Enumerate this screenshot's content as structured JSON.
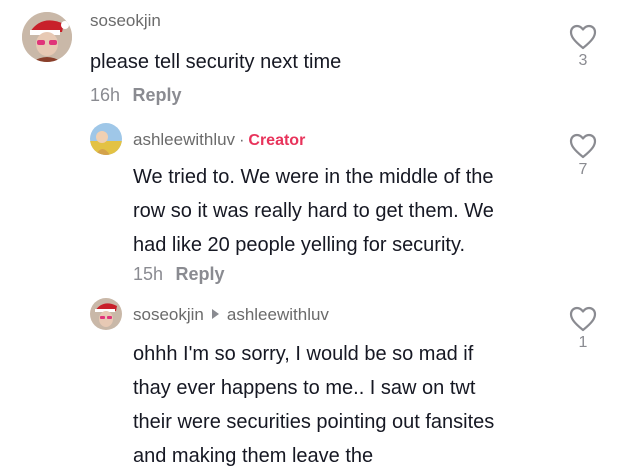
{
  "comments": [
    {
      "username": "soseokjin",
      "text": "please tell security next time",
      "time": "16h",
      "reply_label": "Reply",
      "likes": "3",
      "avatar": "christmas-hat-avatar"
    },
    {
      "username": "ashleewithluv",
      "creator_badge": "Creator",
      "lines": [
        "We tried to. We were in the middle of the",
        "row so it was really hard to get them. We",
        "had like 20 people yelling for security."
      ],
      "time": "15h",
      "reply_label": "Reply",
      "likes": "7",
      "avatar": "outdoor-avatar"
    },
    {
      "username": "soseokjin",
      "reply_to": "ashleewithluv",
      "lines": [
        "ohhh I'm so sorry, I would be so mad if",
        "thay ever happens to me.. I saw on twt",
        "their were securities pointing out fansites",
        "and making them leave the"
      ],
      "likes": "1",
      "avatar": "christmas-hat-avatar"
    }
  ],
  "colors": {
    "text": "#161823",
    "muted": "#8a8b91",
    "creator": "#e8335b"
  }
}
